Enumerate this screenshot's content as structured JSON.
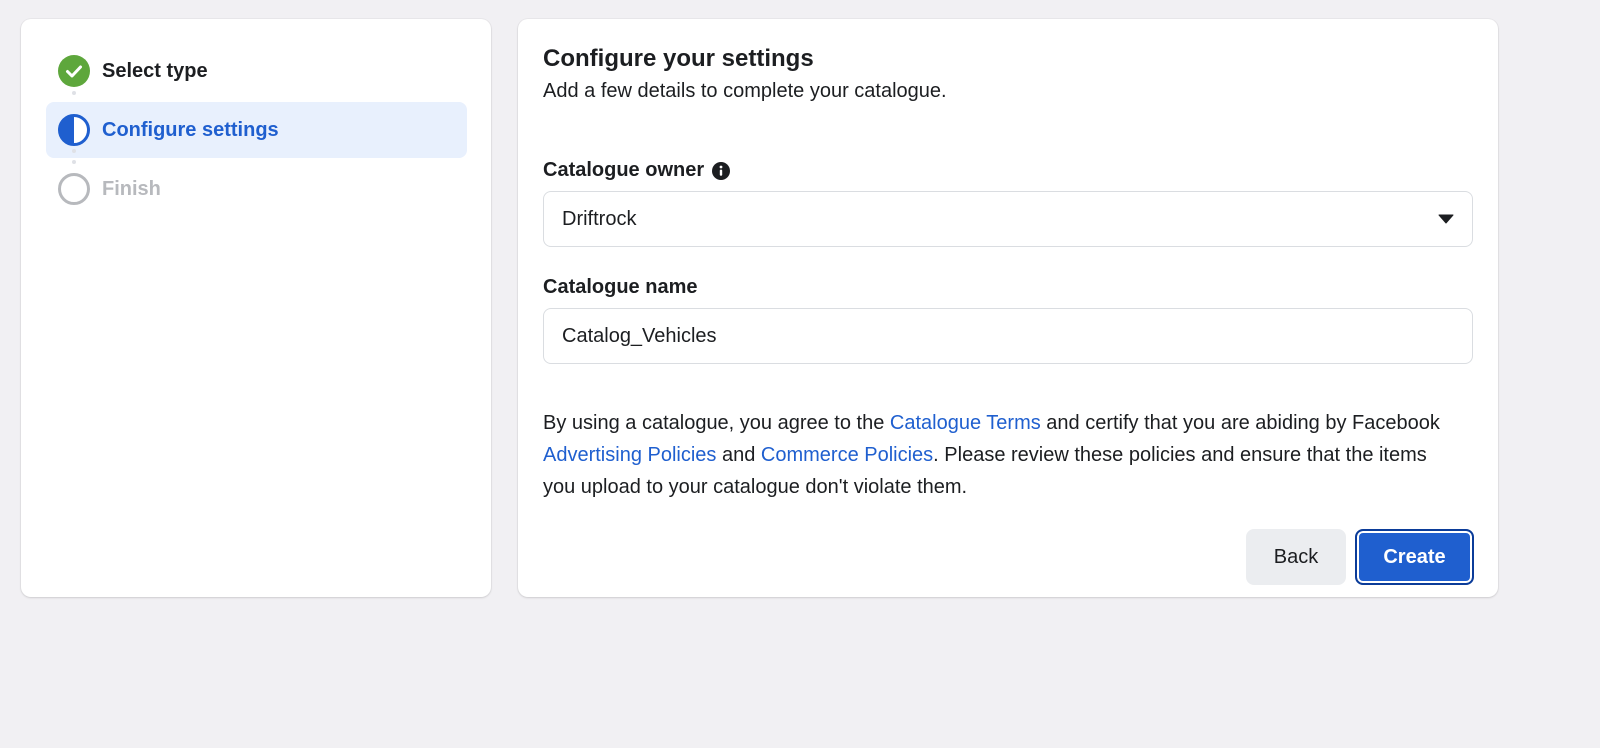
{
  "steps": [
    {
      "label": "Select type",
      "state": "complete"
    },
    {
      "label": "Configure settings",
      "state": "current"
    },
    {
      "label": "Finish",
      "state": "pending"
    }
  ],
  "settings": {
    "title": "Configure your settings",
    "subtitle": "Add a few details to complete your catalogue.",
    "owner": {
      "label": "Catalogue owner",
      "value": "Driftrock"
    },
    "name": {
      "label": "Catalogue name",
      "value": "Catalog_Vehicles"
    },
    "policy": {
      "text_1": "By using a catalogue, you agree to the ",
      "link_terms": "Catalogue Terms",
      "text_2": " and certify that you are abiding by Facebook ",
      "link_advertising": "Advertising Policies",
      "text_3": " and ",
      "link_commerce": "Commerce Policies",
      "text_4": ". Please review these policies and ensure that the items you upload to your catalogue don't violate them."
    },
    "back_label": "Back",
    "create_label": "Create"
  },
  "colors": {
    "accent": "#1f5fcf",
    "success": "#5ea73c",
    "active_bg": "#e8f0fd",
    "pending": "#b7b9bd"
  }
}
